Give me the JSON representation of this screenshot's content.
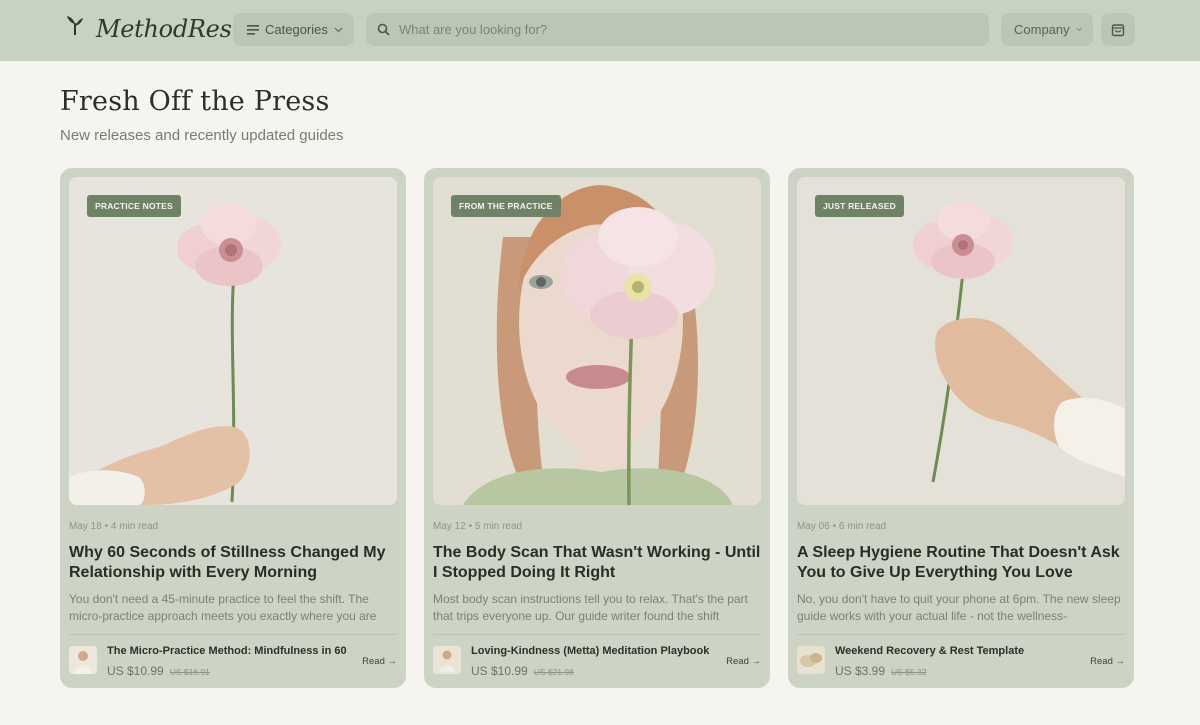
{
  "brand": {
    "name": "MethodRest"
  },
  "nav": {
    "categories_label": "Categories",
    "search_placeholder": "What are you looking for?",
    "company_label": "Company"
  },
  "section": {
    "title": "Fresh Off the Press",
    "subtitle": "New releases and recently updated guides"
  },
  "cards": [
    {
      "tag": "PRACTICE NOTES",
      "meta": "May 18 • 4 min read",
      "title": "Why 60 Seconds of Stillness Changed My Relationship with Every Morning",
      "excerpt": "You don't need a 45-minute practice to feel the shift. The micro-practice approach meets you exactly where you are",
      "product": "The Micro-Practice Method: Mindfulness in 60",
      "price": "US $10.99",
      "old_price": "US $16.91",
      "read": "Read →"
    },
    {
      "tag": "FROM THE PRACTICE",
      "meta": "May 12 • 5 min read",
      "title": "The Body Scan That Wasn't Working - Until I Stopped Doing It Right",
      "excerpt": "Most body scan instructions tell you to relax. That's the part that trips everyone up. Our guide writer found the shift",
      "product": "Loving-Kindness (Metta) Meditation Playbook",
      "price": "US $10.99",
      "old_price": "US $21.98",
      "read": "Read →"
    },
    {
      "tag": "JUST RELEASED",
      "meta": "May 06 • 6 min read",
      "title": "A Sleep Hygiene Routine That Doesn't Ask You to Give Up Everything You Love",
      "excerpt": "No, you don't have to quit your phone at 6pm. The new sleep guide works with your actual life - not the wellness-",
      "product": "Weekend Recovery & Rest Template",
      "price": "US $3.99",
      "old_price": "US $5.32",
      "read": "Read →"
    }
  ]
}
